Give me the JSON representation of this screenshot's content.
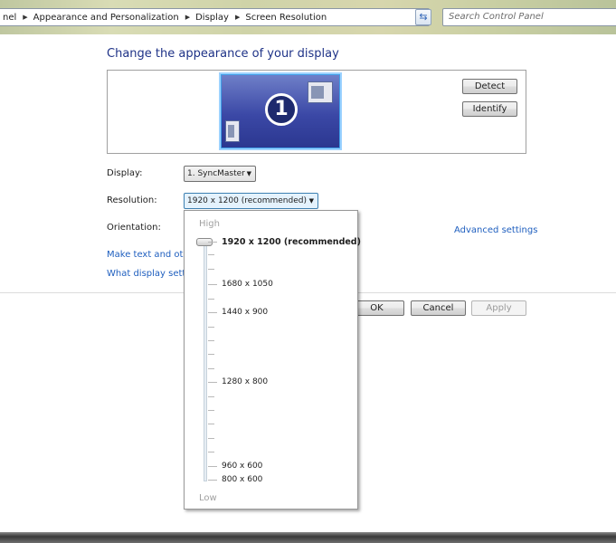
{
  "address_bar": {
    "crumbs": [
      "nel",
      "Appearance and Personalization",
      "Display",
      "Screen Resolution"
    ],
    "refresh_glyph": "⇆",
    "search_placeholder": "Search Control Panel"
  },
  "main": {
    "title": "Change the appearance of your display",
    "monitor_number": "1",
    "detect_label": "Detect",
    "identify_label": "Identify",
    "display_label": "Display:",
    "display_value": "1. SyncMaster",
    "resolution_label": "Resolution:",
    "resolution_value": "1920 x 1200 (recommended)",
    "orientation_label": "Orientation:",
    "advanced_settings": "Advanced settings",
    "link_text_size": "Make text and other",
    "link_display_settings": "What display setting",
    "ok_label": "OK",
    "cancel_label": "Cancel",
    "apply_label": "Apply"
  },
  "popup": {
    "high_label": "High",
    "low_label": "Low",
    "resolutions": [
      "1920 x 1200 (recommended)",
      "1680 x 1050",
      "1440 x 900",
      "1280 x 800",
      "960 x 600",
      "800 x 600"
    ],
    "selected": "1920 x 1200 (recommended)"
  }
}
